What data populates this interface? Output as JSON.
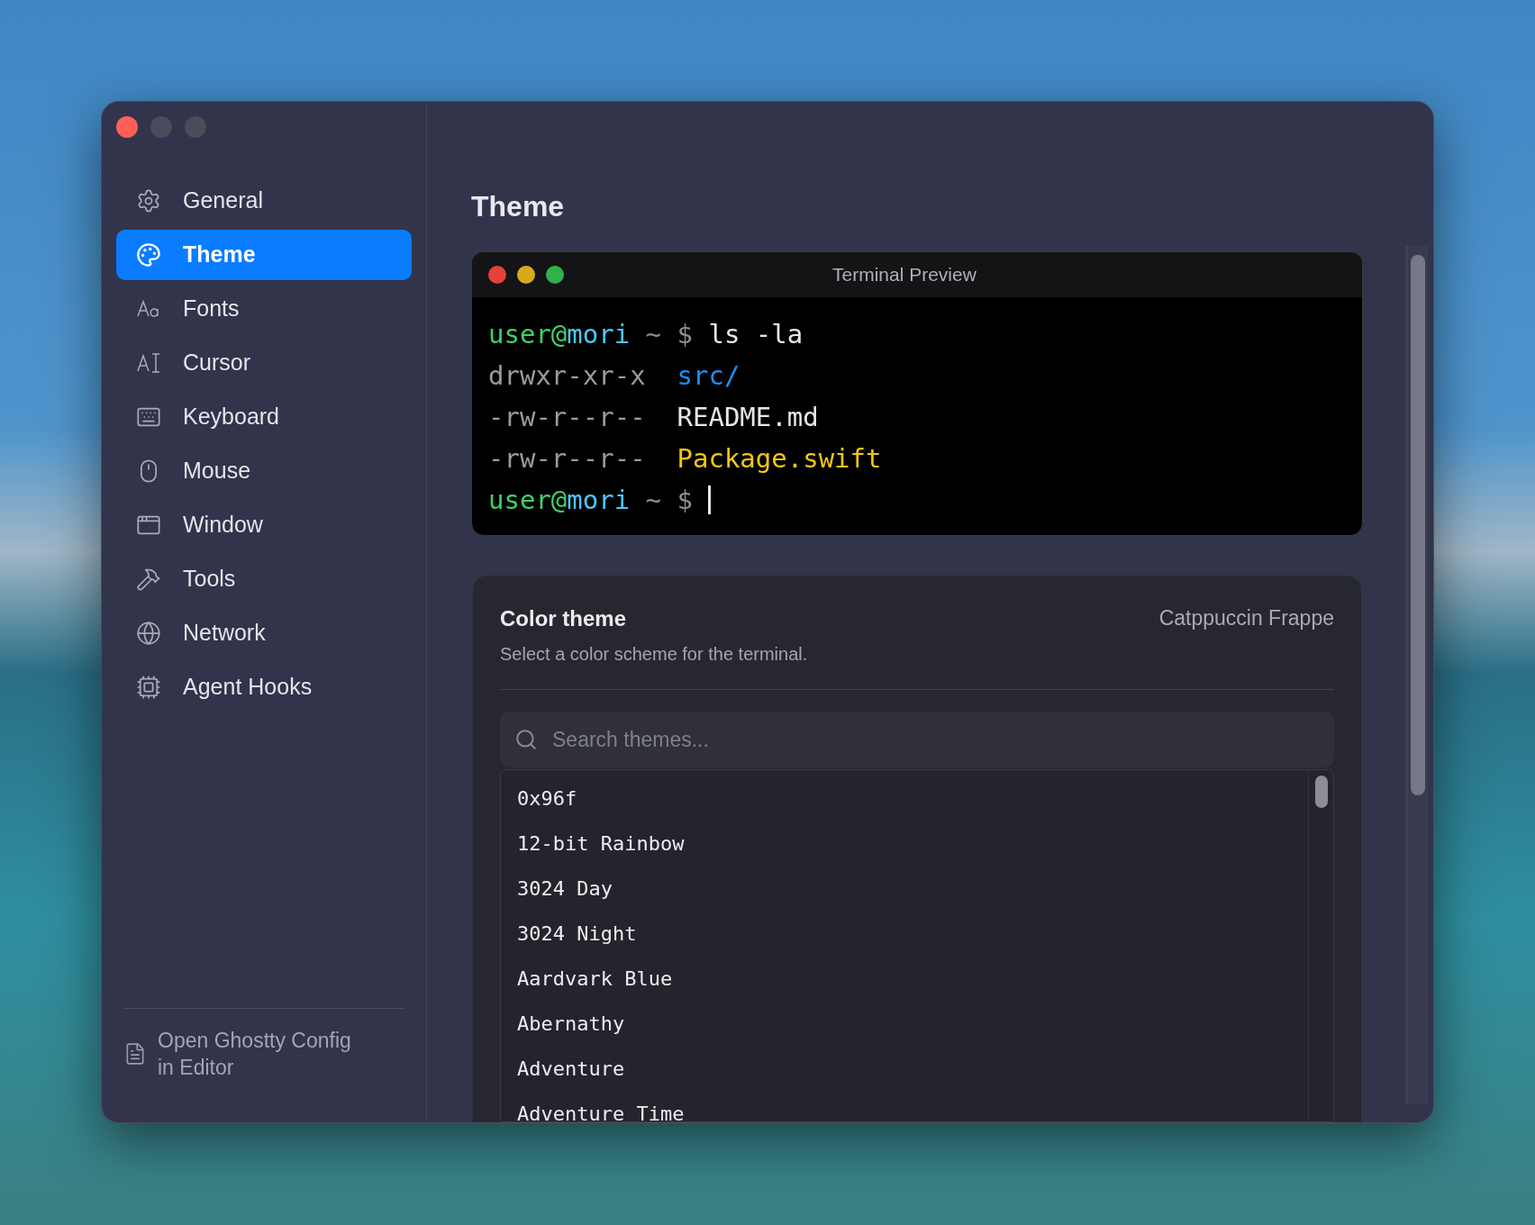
{
  "sidebar": {
    "items": [
      {
        "label": "General",
        "selected": false
      },
      {
        "label": "Theme",
        "selected": true
      },
      {
        "label": "Fonts",
        "selected": false
      },
      {
        "label": "Cursor",
        "selected": false
      },
      {
        "label": "Keyboard",
        "selected": false
      },
      {
        "label": "Mouse",
        "selected": false
      },
      {
        "label": "Window",
        "selected": false
      },
      {
        "label": "Tools",
        "selected": false
      },
      {
        "label": "Network",
        "selected": false
      },
      {
        "label": "Agent Hooks",
        "selected": false
      }
    ],
    "footer_link": "Open Ghostty Config in Editor"
  },
  "page_title": "Theme",
  "terminal_preview": {
    "title": "Terminal Preview",
    "lines": [
      {
        "segments": [
          {
            "text": "user",
            "color": "#3fcf6a"
          },
          {
            "text": "@",
            "color": "#3fcf6a"
          },
          {
            "text": "mori",
            "color": "#4fc6f5"
          },
          {
            "text": " ~ $ ",
            "color": "#8e8e93"
          },
          {
            "text": "ls -la",
            "color": "#e6e6e6"
          }
        ],
        "cursor": false
      },
      {
        "segments": [
          {
            "text": "drwxr-xr-x  ",
            "color": "#9a9a9a"
          },
          {
            "text": "src/",
            "color": "#1e8ff5"
          }
        ],
        "cursor": false
      },
      {
        "segments": [
          {
            "text": "-rw-r--r--  ",
            "color": "#9a9a9a"
          },
          {
            "text": "README.md",
            "color": "#e6e6e6"
          }
        ],
        "cursor": false
      },
      {
        "segments": [
          {
            "text": "-rw-r--r--  ",
            "color": "#9a9a9a"
          },
          {
            "text": "Package.swift",
            "color": "#f5c518"
          }
        ],
        "cursor": false
      },
      {
        "segments": [
          {
            "text": "user",
            "color": "#3fcf6a"
          },
          {
            "text": "@",
            "color": "#3fcf6a"
          },
          {
            "text": "mori",
            "color": "#4fc6f5"
          },
          {
            "text": " ~ $ ",
            "color": "#8e8e93"
          }
        ],
        "cursor": true
      }
    ]
  },
  "color_theme": {
    "title": "Color theme",
    "description": "Select a color scheme for the terminal.",
    "current": "Catppuccin Frappe",
    "search": {
      "placeholder": "Search themes..."
    },
    "themes": [
      "0x96f",
      "12-bit Rainbow",
      "3024 Day",
      "3024 Night",
      "Aardvark Blue",
      "Abernathy",
      "Adventure",
      "Adventure Time"
    ]
  }
}
